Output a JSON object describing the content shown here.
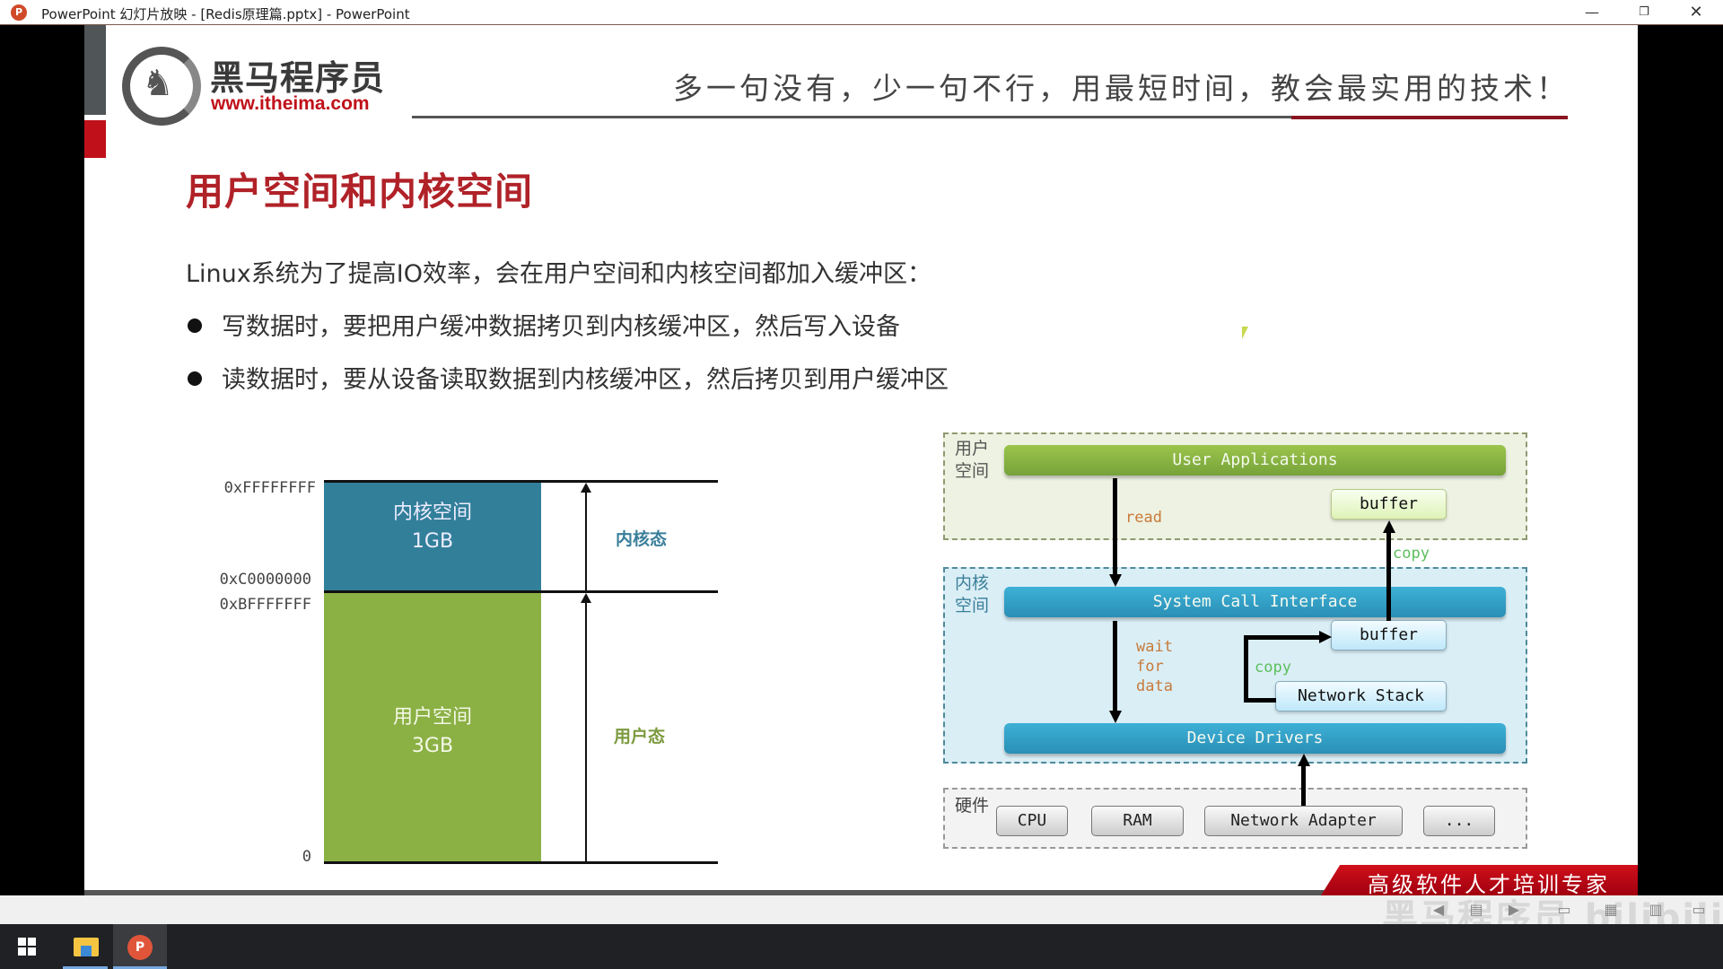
{
  "window": {
    "title": "PowerPoint 幻灯片放映 - [Redis原理篇.pptx] - PowerPoint",
    "app_icon": "powerpoint-icon",
    "controls": {
      "minimize": "—",
      "restore": "❐",
      "close": "✕"
    }
  },
  "slide": {
    "logo": {
      "name_cn": "黑马程序员",
      "url": "www.itheima.com",
      "icon": "horse-logo-icon"
    },
    "slogan": "多一句没有，少一句不行，用最短时间，教会最实用的技术！",
    "title": "用户空间和内核空间",
    "intro": "Linux系统为了提高IO效率，会在用户空间和内核空间都加入缓冲区：",
    "bullets": [
      "写数据时，要把用户缓冲数据拷贝到内核缓冲区，然后写入设备",
      "读数据时，要从设备读取数据到内核缓冲区，然后拷贝到用户缓冲区"
    ],
    "memory_diagram": {
      "addresses": {
        "top": "0xFFFFFFFF",
        "kernel_start": "0xC0000000",
        "user_end": "0xBFFFFFFF",
        "bottom": "0"
      },
      "kernel_space": {
        "label": "内核空间",
        "size": "1GB",
        "color": "#327f9a"
      },
      "user_space": {
        "label": "用户空间",
        "size": "3GB",
        "color": "#8bb044"
      },
      "states": {
        "kernel": "内核态",
        "user": "用户态"
      }
    },
    "io_diagram": {
      "zones": {
        "user": "用户\n空间",
        "user_l1": "用户",
        "user_l2": "空间",
        "kernel_l1": "内核",
        "kernel_l2": "空间",
        "hardware": "硬件"
      },
      "bars": {
        "user_apps": "User Applications",
        "syscall": "System Call Interface",
        "drivers": "Device Drivers"
      },
      "boxes": {
        "user_buffer": "buffer",
        "kernel_buffer": "buffer",
        "network_stack": "Network Stack"
      },
      "annotations": {
        "read": "read",
        "copy_up": "copy",
        "wait1": "wait",
        "wait2": "for",
        "wait3": "data",
        "copy_inner": "copy"
      },
      "hardware": [
        "CPU",
        "RAM",
        "Network Adapter",
        "..."
      ]
    },
    "ribbon": "高级软件人才培训专家"
  },
  "slideshow_controls": {
    "prev": "◀",
    "menu": "▤",
    "next": "▶",
    "normal_view": "▭",
    "slide_sorter": "▦",
    "reading_view": "▥",
    "slideshow": "▭"
  },
  "watermark": "黑马程序员 bilibili",
  "taskbar": {
    "items": [
      {
        "name": "start",
        "icon": "windows-icon"
      },
      {
        "name": "file-explorer",
        "icon": "folder-icon"
      },
      {
        "name": "powerpoint",
        "icon": "powerpoint-icon",
        "label": "P"
      }
    ]
  }
}
